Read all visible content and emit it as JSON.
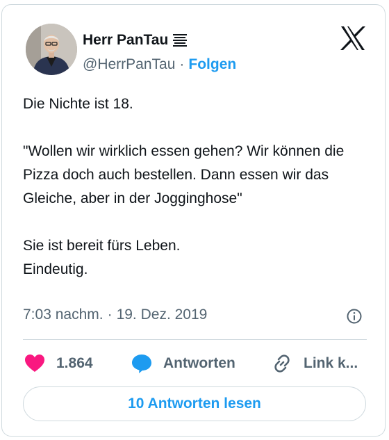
{
  "author": {
    "display_name": "Herr PanTau",
    "handle": "@HerrPanTau",
    "separator": "·",
    "follow_label": "Folgen"
  },
  "tweet": {
    "paragraphs": [
      "Die Nichte ist 18.",
      "\"Wollen wir wirklich essen gehen? Wir können die Pizza doch auch bestellen. Dann essen wir das Gleiche, aber in der Jogginghose\"",
      "Sie ist bereit fürs Leben.\nEindeutig."
    ]
  },
  "meta": {
    "time": "7:03 nachm.",
    "separator": "·",
    "date": "19. Dez. 2019"
  },
  "actions": {
    "like_count": "1.864",
    "reply_label": "Antworten",
    "link_label": "Link k..."
  },
  "read_replies_label": "10 Antworten lesen",
  "colors": {
    "accent": "#1d9bf0",
    "like": "#f91880",
    "text": "#0f1419",
    "muted": "#536471",
    "border": "#cfd9de"
  },
  "icons": {
    "menu": "lines-icon",
    "platform": "x-logo-icon",
    "info": "info-icon",
    "like": "heart-icon",
    "reply": "speech-bubble-icon",
    "link": "link-icon"
  }
}
